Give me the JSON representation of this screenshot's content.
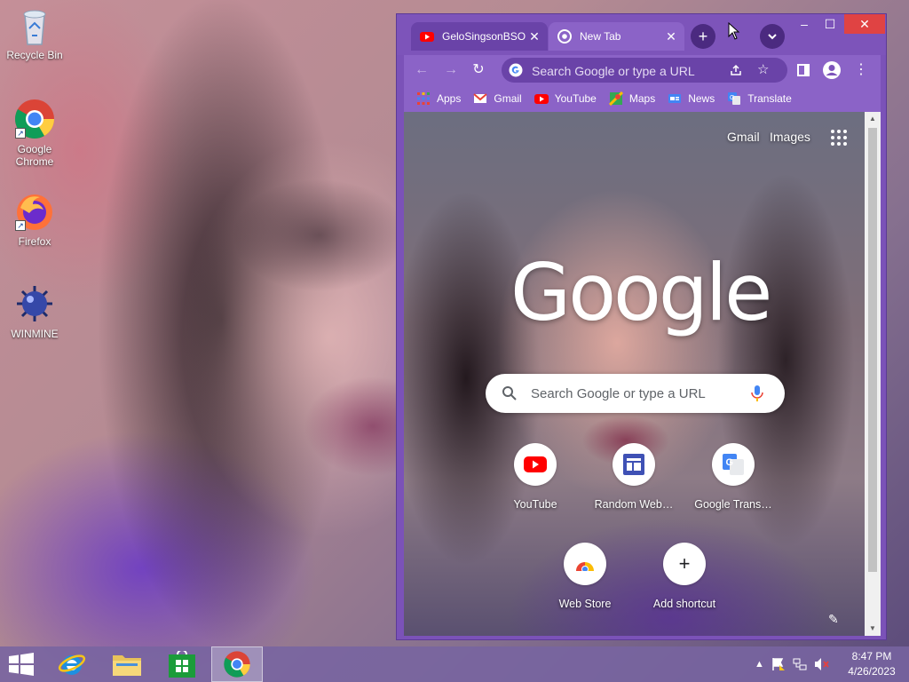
{
  "desktop": {
    "icons": [
      {
        "label": "Recycle Bin"
      },
      {
        "label": "Google\nChrome"
      },
      {
        "label": "Firefox"
      },
      {
        "label": "WINMINE"
      }
    ]
  },
  "browser": {
    "tabs": [
      {
        "title": "GeloSingsonBSO",
        "icon": "youtube-icon",
        "active": false
      },
      {
        "title": "New Tab",
        "icon": "chrome-icon",
        "active": true
      }
    ],
    "window_controls": {
      "minimize": "–",
      "maximize": "☐",
      "close": "✕"
    },
    "omnibox": {
      "placeholder": "Search Google or type a URL"
    },
    "bookmarks": [
      {
        "label": "Apps",
        "icon": "apps-grid-icon"
      },
      {
        "label": "Gmail",
        "icon": "gmail-icon"
      },
      {
        "label": "YouTube",
        "icon": "youtube-icon"
      },
      {
        "label": "Maps",
        "icon": "maps-icon"
      },
      {
        "label": "News",
        "icon": "news-icon"
      },
      {
        "label": "Translate",
        "icon": "translate-icon"
      }
    ],
    "theme_colors": {
      "frame": "#7d54ba",
      "toolbar": "#8b63c7",
      "tab_inactive": "#6a43a8"
    }
  },
  "newtab": {
    "top_links": {
      "gmail": "Gmail",
      "images": "Images"
    },
    "logo_text": "Google",
    "search_placeholder": "Search Google or type a URL",
    "shortcuts": [
      {
        "label": "YouTube"
      },
      {
        "label": "Random Web…"
      },
      {
        "label": "Google Trans…"
      },
      {
        "label": "Web Store"
      },
      {
        "label": "Add shortcut"
      }
    ]
  },
  "taskbar": {
    "pinned": [
      "start-button",
      "internet-explorer",
      "file-explorer",
      "store",
      "google-chrome"
    ],
    "clock": {
      "time": "8:47 PM",
      "date": "4/26/2023"
    }
  }
}
